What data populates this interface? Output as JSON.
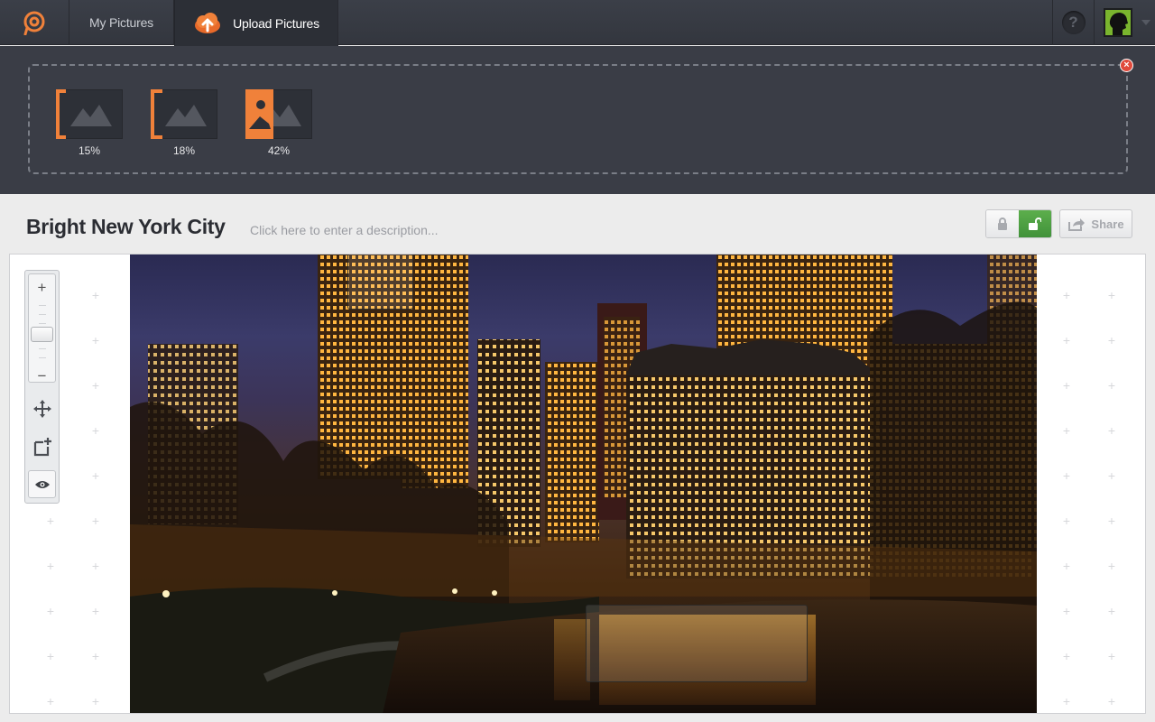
{
  "nav": {
    "logo_icon": "camera-p-logo-icon",
    "my_pictures": "My Pictures",
    "upload_pictures": "Upload Pictures",
    "upload_icon": "cloud-upload-icon",
    "help": "?",
    "accent": "#f0813a"
  },
  "uploads": {
    "items": [
      {
        "percent": "15%",
        "progress": 0.15
      },
      {
        "percent": "18%",
        "progress": 0.18
      },
      {
        "percent": "42%",
        "progress": 0.42
      }
    ],
    "close_icon": "close-icon"
  },
  "picture": {
    "title": "Bright New York City",
    "description_placeholder": "Click here to enter a description...",
    "share": "Share",
    "lock_state": "unlocked",
    "lock_active_color": "#4aa040"
  },
  "tools": {
    "zoom_in": "+",
    "zoom_out": "−",
    "items": [
      "move-icon",
      "add-frame-icon",
      "eye-icon"
    ]
  }
}
